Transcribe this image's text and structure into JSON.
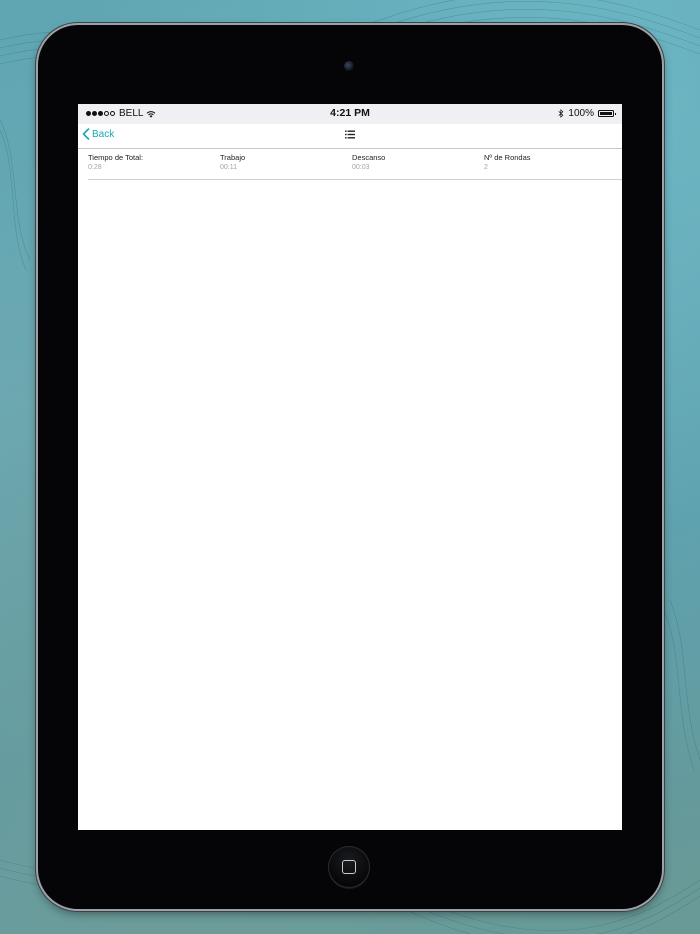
{
  "status_bar": {
    "signal_dots": [
      true,
      true,
      true,
      false,
      false
    ],
    "carrier": "BELL",
    "time": "4:21 PM",
    "battery_percent": "100%",
    "icons": [
      "wifi-icon",
      "bluetooth-icon",
      "battery-icon"
    ]
  },
  "nav": {
    "back_label": "Back",
    "center_icon": "list-icon"
  },
  "summary": [
    {
      "label": "Tiempo de Total:",
      "value": "0:28"
    },
    {
      "label": "Trabajo",
      "value": "00:11"
    },
    {
      "label": "Descanso",
      "value": "00:03"
    },
    {
      "label": "Nº de Rondas",
      "value": "2"
    }
  ],
  "colors": {
    "accent": "#1aa7b8",
    "device_bezel": "#050507",
    "status_bar_bg": "#efeff4",
    "secondary_text": "#a4a4a8"
  }
}
